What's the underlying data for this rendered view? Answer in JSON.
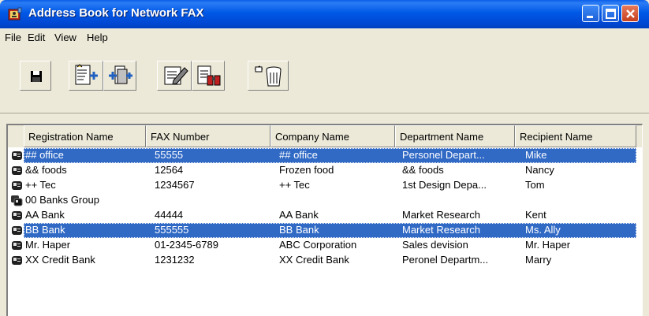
{
  "window": {
    "title": "Address Book for Network FAX"
  },
  "menu": [
    "File",
    "Edit",
    "View",
    "Help"
  ],
  "toolbar": {
    "buttons": [
      {
        "name": "save-button",
        "icon": "floppy-disk-icon"
      },
      {
        "name": "new-entry-button",
        "icon": "new-entry-icon"
      },
      {
        "name": "new-group-button",
        "icon": "new-group-icon"
      },
      {
        "name": "edit-button",
        "icon": "edit-pencil-icon"
      },
      {
        "name": "search-button",
        "icon": "binoculars-icon"
      },
      {
        "name": "delete-button",
        "icon": "trash-icon"
      }
    ]
  },
  "table": {
    "columns": [
      "Registration Name",
      "FAX Number",
      "Company Name",
      "Department Name",
      "Recipient Name"
    ],
    "rows": [
      {
        "type": "person",
        "selected": true,
        "cells": [
          "## office",
          "55555",
          "## office",
          "Personel Depart...",
          "Mike"
        ]
      },
      {
        "type": "person",
        "selected": false,
        "cells": [
          "&& foods",
          "12564",
          "Frozen food",
          "&& foods",
          "Nancy"
        ]
      },
      {
        "type": "person",
        "selected": false,
        "cells": [
          "++ Tec",
          "1234567",
          "++ Tec",
          "1st Design Depa...",
          "Tom"
        ]
      },
      {
        "type": "group",
        "selected": false,
        "cells": [
          "00 Banks Group",
          "",
          "",
          "",
          ""
        ]
      },
      {
        "type": "person",
        "selected": false,
        "cells": [
          "AA Bank",
          "44444",
          "AA Bank",
          "Market Research",
          "Kent"
        ]
      },
      {
        "type": "person",
        "selected": true,
        "cells": [
          "BB Bank",
          "555555",
          "BB Bank",
          "Market Research",
          "Ms. Ally"
        ]
      },
      {
        "type": "person",
        "selected": false,
        "cells": [
          "Mr. Haper",
          "01-2345-6789",
          "ABC Corporation",
          "Sales devision",
          "Mr. Haper"
        ]
      },
      {
        "type": "person",
        "selected": false,
        "cells": [
          "XX Credit Bank",
          "1231232",
          "XX Credit Bank",
          "Peronel Departm...",
          "Marry"
        ]
      }
    ]
  },
  "colors": {
    "selection": "#316ac5",
    "titlebar": "#0058e6",
    "face": "#ece9d8"
  }
}
